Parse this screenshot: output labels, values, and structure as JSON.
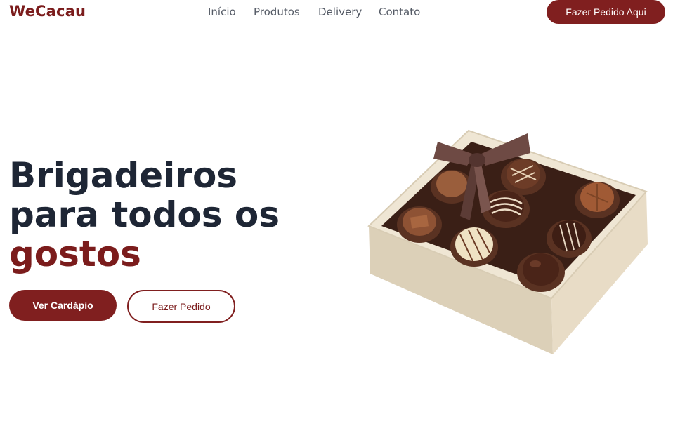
{
  "brand": {
    "logo": "WeCacau",
    "accent_color": "#801f1f"
  },
  "nav": {
    "links": [
      "Início",
      "Produtos",
      "Delivery",
      "Contato"
    ],
    "cta": "Fazer Pedido Aqui"
  },
  "hero": {
    "title_line1": "Brigadeiros",
    "title_line2": "para todos os",
    "title_accent": "gostos",
    "primary_button": "Ver Cardápio",
    "secondary_button": "Fazer Pedido",
    "image": "chocolate-gift-box"
  }
}
